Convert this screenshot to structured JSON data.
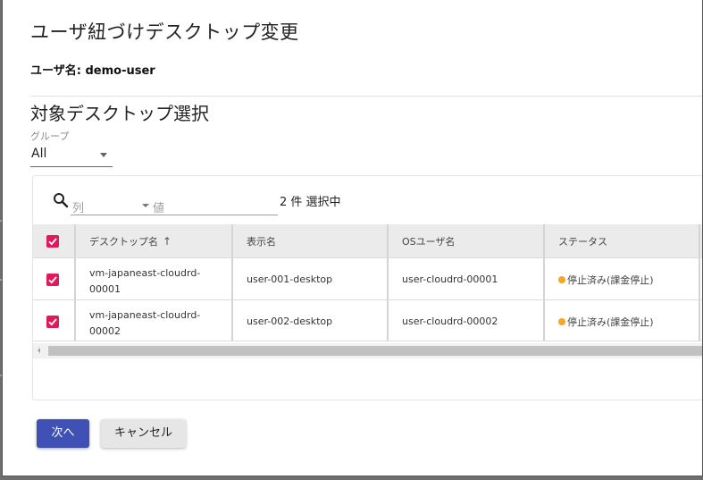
{
  "dialog": {
    "title": "ユーザ紐づけデスクトップ変更",
    "user_line": "ユーザ名: demo-user",
    "section_title": "対象デスクトップ選択"
  },
  "group_filter": {
    "label": "グループ",
    "value": "All"
  },
  "toolbar": {
    "search_icon": "search-icon",
    "column_placeholder": "列",
    "value_placeholder": "値",
    "selected_count": "2 件 選択中"
  },
  "table": {
    "columns": [
      "デスクトップ名",
      "表示名",
      "OSユーザ名",
      "ステータス"
    ],
    "sort_indicator": "↑",
    "rows": [
      {
        "desktop_name_line1": "vm-japaneast-cloudrd-",
        "desktop_name_line2": "00001",
        "display_name": "user-001-desktop",
        "os_user": "user-cloudrd-00001",
        "status": "停止済み(課金停止)",
        "checked": true
      },
      {
        "desktop_name_line1": "vm-japaneast-cloudrd-",
        "desktop_name_line2": "00002",
        "display_name": "user-002-desktop",
        "os_user": "user-cloudrd-00002",
        "status": "停止済み(課金停止)",
        "checked": true
      }
    ]
  },
  "buttons": {
    "next": "次へ",
    "cancel": "キャンセル"
  },
  "colors": {
    "primary": "#3f51b5",
    "checkbox": "#e0195a",
    "status_stopped": "#f5a623"
  }
}
